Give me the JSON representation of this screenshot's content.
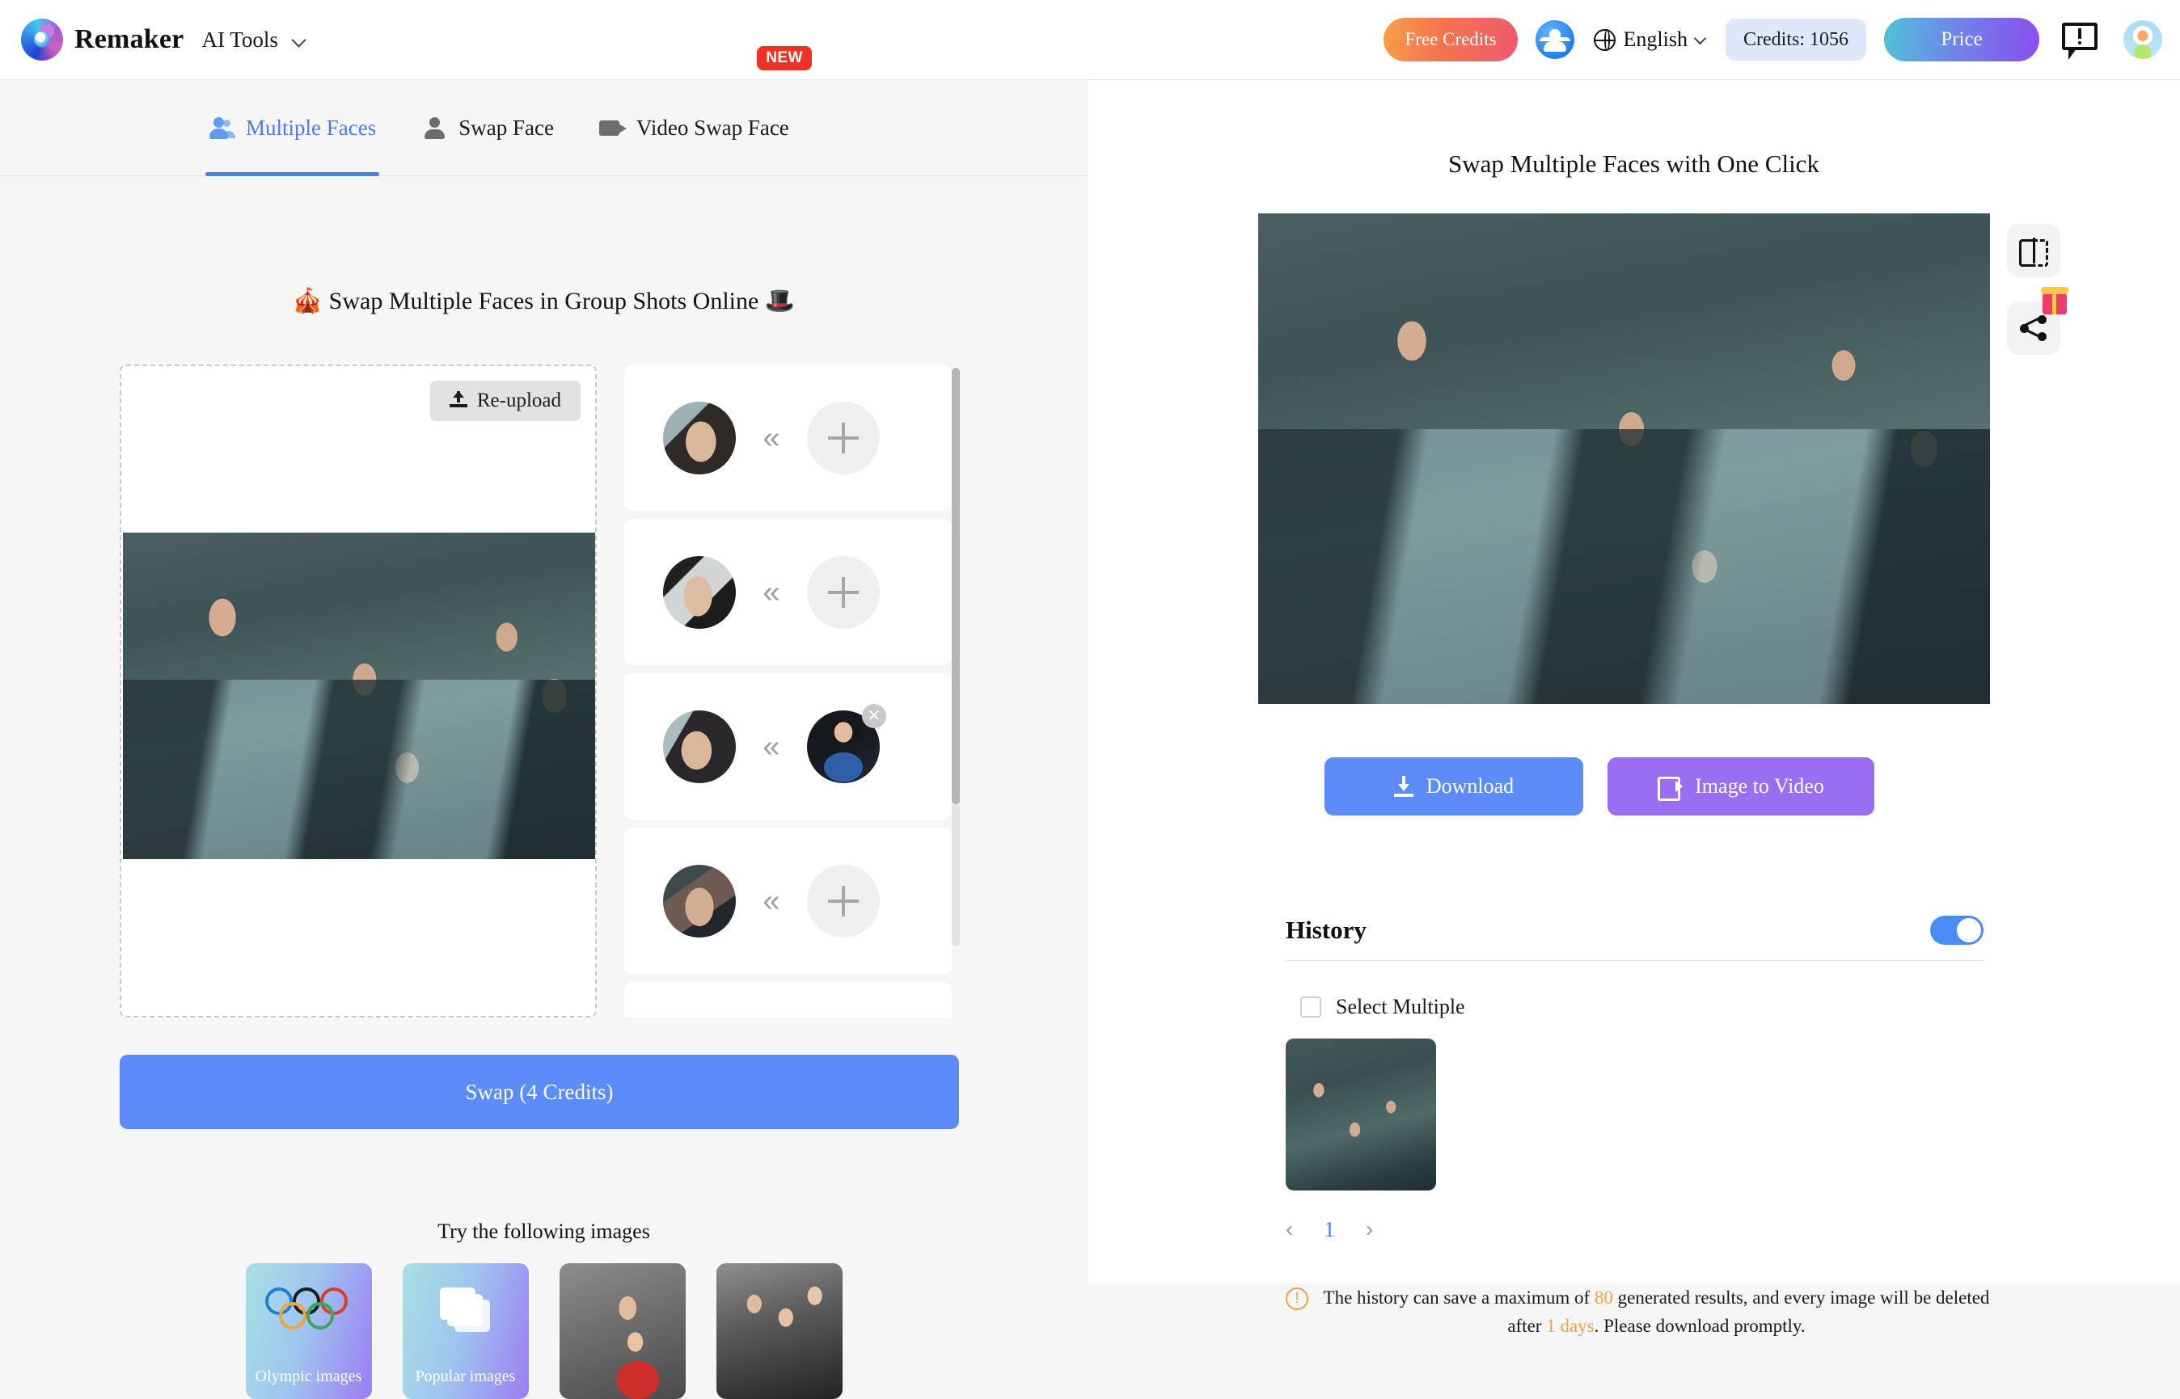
{
  "header": {
    "brand_name": "Remaker",
    "ai_tools_label": "AI Tools",
    "free_credits_label": "Free Credits",
    "language_label": "English",
    "credits_label": "Credits: 1056",
    "price_label": "Price",
    "icons": {
      "logo": "remaker-logo",
      "people": "people-group-icon",
      "globe": "globe-icon",
      "chevron": "chevron-down-icon",
      "feedback": "feedback-icon",
      "avatar": "user-avatar"
    }
  },
  "tabs": [
    {
      "label": "Multiple Faces",
      "icon": "multiple-faces-icon",
      "active": true,
      "badge": ""
    },
    {
      "label": "Swap Face",
      "icon": "person-icon",
      "active": false,
      "badge": ""
    },
    {
      "label": "Video Swap Face",
      "icon": "video-camera-icon",
      "active": false,
      "badge": "NEW"
    }
  ],
  "left": {
    "heading_prefix_emoji": "🎪",
    "heading": "Swap Multiple Faces in Group Shots Online",
    "heading_suffix_emoji": "🎩",
    "reupload_label": "Re-upload",
    "face_rows": [
      {
        "source": "detected-face-1",
        "target": null,
        "has_remove": false
      },
      {
        "source": "detected-face-2",
        "target": null,
        "has_remove": false
      },
      {
        "source": "detected-face-3",
        "target": "uploaded-face",
        "has_remove": true
      },
      {
        "source": "detected-face-4",
        "target": null,
        "has_remove": false
      },
      {
        "source": "detected-face-5",
        "target": null,
        "has_remove": false
      }
    ],
    "swap_button_label": "Swap (4 Credits)",
    "try_label": "Try the following images",
    "try_cards": [
      {
        "label": "Olympic images",
        "kind": "olympic-rings"
      },
      {
        "label": "Popular images",
        "kind": "popular-photos"
      },
      {
        "label": "",
        "kind": "sample-photo-couple"
      },
      {
        "label": "",
        "kind": "sample-photo-trio"
      }
    ]
  },
  "right": {
    "result_title": "Swap Multiple Faces with One Click",
    "tools": [
      {
        "name": "compare-icon"
      },
      {
        "name": "share-icon"
      }
    ],
    "download_label": "Download",
    "image_to_video_label": "Image to Video",
    "history_title": "History",
    "history_toggle_on": true,
    "select_multiple_label": "Select Multiple",
    "pagination": {
      "prev": "‹",
      "page": "1",
      "next": "›"
    },
    "notice": {
      "part1": "The history can save a maximum of ",
      "max": "80",
      "part2": " generated results, and every image will be deleted after ",
      "days": "1 days",
      "part3": ". Please download promptly."
    }
  }
}
